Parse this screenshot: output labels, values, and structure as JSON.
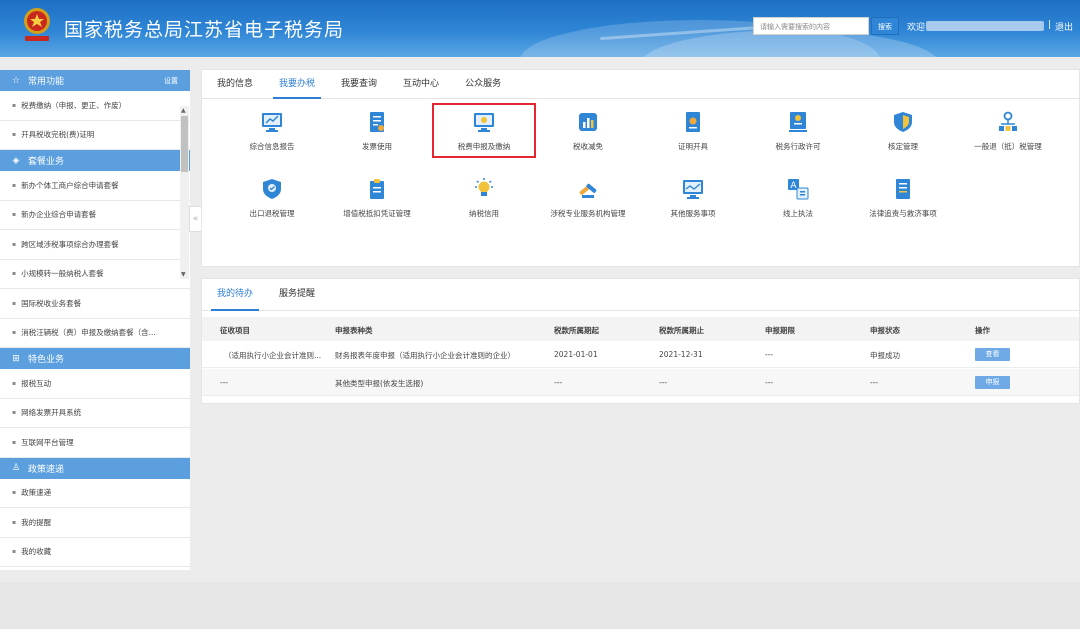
{
  "header": {
    "title": "国家税务总局江苏省电子税务局",
    "search_placeholder": "请输入需要搜索的内容",
    "search_button": "搜索",
    "welcome": "欢迎",
    "separator": "|",
    "logout": "退出"
  },
  "sidebar": {
    "sections": [
      {
        "title": "常用功能",
        "icon": "star-icon",
        "settings": "设置",
        "items": [
          "税费缴纳（申报、更正、作废）",
          "开具税收完税(费)证明"
        ]
      },
      {
        "title": "套餐业务",
        "icon": "layers-icon",
        "items": [
          "新办个体工商户综合申请套餐",
          "新办企业综合申请套餐",
          "跨区域涉税事项综合办理套餐",
          "小规模转一般纳税人套餐",
          "国际税收业务套餐",
          "消税汪辆税（费）申报及缴纳套餐（含..."
        ]
      },
      {
        "title": "特色业务",
        "icon": "grid-icon",
        "items": [
          "报税互动",
          "网络发票开具系统",
          "互联网平台管理"
        ]
      },
      {
        "title": "政策速递",
        "icon": "person-icon",
        "items": [
          "政策速递",
          "我的提醒",
          "我的收藏"
        ]
      }
    ],
    "collapse_label": "«"
  },
  "main": {
    "tabs": [
      "我的信息",
      "我要办税",
      "我要查询",
      "互动中心",
      "公众服务"
    ],
    "active_tab": 1,
    "services_row1": [
      {
        "label": "综合信息报告",
        "icon": "monitor-chart-icon"
      },
      {
        "label": "发票使用",
        "icon": "invoice-icon"
      },
      {
        "label": "税费申报及缴纳",
        "icon": "monitor-sun-icon"
      },
      {
        "label": "税收减免",
        "icon": "bar-chart-icon"
      },
      {
        "label": "证明开具",
        "icon": "certificate-icon"
      },
      {
        "label": "税务行政许可",
        "icon": "license-icon"
      },
      {
        "label": "核定管理",
        "icon": "shield-check-icon"
      },
      {
        "label": "一般退（抵）税管理",
        "icon": "org-chart-icon"
      }
    ],
    "services_row2": [
      {
        "label": "出口退税管理",
        "icon": "shield-badge-icon"
      },
      {
        "label": "增值税抵扣凭证管理",
        "icon": "clipboard-icon"
      },
      {
        "label": "纳税信用",
        "icon": "lightbulb-icon"
      },
      {
        "label": "涉税专业服务机构管理",
        "icon": "tools-icon"
      },
      {
        "label": "其他服务事项",
        "icon": "monitor-line-icon"
      },
      {
        "label": "线上执法",
        "icon": "translate-icon"
      },
      {
        "label": "法律追责与救济事项",
        "icon": "document-icon"
      }
    ]
  },
  "todo": {
    "tabs": [
      "我的待办",
      "服务提醒"
    ],
    "active_tab": 0,
    "columns": [
      "征收项目",
      "申报表种类",
      "税款所属期起",
      "税款所属期止",
      "申报期限",
      "申报状态",
      "操作"
    ],
    "rows": [
      [
        "（适用执行小企业会计准则...",
        "财务报表年度申报（适用执行小企业会计准则的企业）",
        "2021-01-01",
        "2021-12-31",
        "---",
        "申报成功",
        "查看"
      ],
      [
        "---",
        "其他类型申报(依发生选报)",
        "---",
        "---",
        "---",
        "---",
        "申报"
      ]
    ]
  },
  "colors": {
    "header_blue": "#2f86d6",
    "section_blue": "#5b9fdf",
    "active_tab": "#2f7fd6",
    "highlight_red": "#e3262f",
    "button_blue": "#6fa9e6"
  }
}
